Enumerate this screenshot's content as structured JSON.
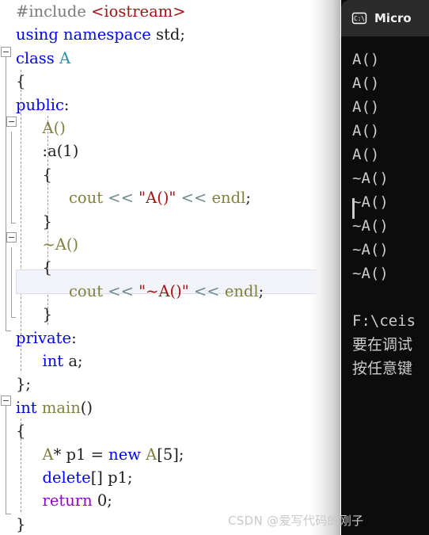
{
  "editor": {
    "lines": [
      {
        "indent": 0,
        "tokens": [
          {
            "t": "#include ",
            "c": "t-pre"
          },
          {
            "t": "<iostream>",
            "c": "t-inc"
          }
        ]
      },
      {
        "indent": 0,
        "tokens": [
          {
            "t": "using namespace",
            "c": "t-kw"
          },
          {
            "t": " std;",
            "c": "t-plain"
          }
        ]
      },
      {
        "indent": 0,
        "tokens": [
          {
            "t": "class",
            "c": "t-kw"
          },
          {
            "t": " ",
            "c": "t-plain"
          },
          {
            "t": "A",
            "c": "t-type"
          }
        ]
      },
      {
        "indent": 0,
        "tokens": [
          {
            "t": "{",
            "c": "t-plain"
          }
        ]
      },
      {
        "indent": 0,
        "tokens": [
          {
            "t": "public",
            "c": "t-kw"
          },
          {
            "t": ":",
            "c": "t-plain"
          }
        ]
      },
      {
        "indent": 1,
        "tokens": [
          {
            "t": "A()",
            "c": "t-ident"
          }
        ]
      },
      {
        "indent": 1,
        "tokens": [
          {
            "t": ":a(1)",
            "c": "t-plain"
          }
        ]
      },
      {
        "indent": 1,
        "tokens": [
          {
            "t": "{",
            "c": "t-plain"
          }
        ]
      },
      {
        "indent": 2,
        "tokens": [
          {
            "t": "cout",
            "c": "t-ident"
          },
          {
            "t": " ",
            "c": "t-plain"
          },
          {
            "t": "<<",
            "c": "t-op"
          },
          {
            "t": " ",
            "c": "t-plain"
          },
          {
            "t": "\"A()\"",
            "c": "t-str"
          },
          {
            "t": " ",
            "c": "t-plain"
          },
          {
            "t": "<<",
            "c": "t-op"
          },
          {
            "t": " ",
            "c": "t-plain"
          },
          {
            "t": "endl",
            "c": "t-ident"
          },
          {
            "t": ";",
            "c": "t-plain"
          }
        ]
      },
      {
        "indent": 1,
        "tokens": [
          {
            "t": "}",
            "c": "t-plain"
          }
        ]
      },
      {
        "indent": 1,
        "tokens": [
          {
            "t": "~A()",
            "c": "t-ident"
          }
        ]
      },
      {
        "indent": 1,
        "tokens": [
          {
            "t": "{",
            "c": "t-plain"
          }
        ]
      },
      {
        "indent": 2,
        "tokens": [
          {
            "t": "cout",
            "c": "t-ident"
          },
          {
            "t": " ",
            "c": "t-plain"
          },
          {
            "t": "<<",
            "c": "t-op"
          },
          {
            "t": " ",
            "c": "t-plain"
          },
          {
            "t": "\"~A()\"",
            "c": "t-str"
          },
          {
            "t": " ",
            "c": "t-plain"
          },
          {
            "t": "<<",
            "c": "t-op"
          },
          {
            "t": " ",
            "c": "t-plain"
          },
          {
            "t": "endl",
            "c": "t-ident"
          },
          {
            "t": ";",
            "c": "t-plain"
          }
        ]
      },
      {
        "indent": 1,
        "tokens": [
          {
            "t": "}",
            "c": "t-plain"
          }
        ]
      },
      {
        "indent": 0,
        "tokens": [
          {
            "t": "private",
            "c": "t-kw"
          },
          {
            "t": ":",
            "c": "t-plain"
          }
        ]
      },
      {
        "indent": 1,
        "tokens": [
          {
            "t": "int",
            "c": "t-kw"
          },
          {
            "t": " a;",
            "c": "t-plain"
          }
        ]
      },
      {
        "indent": 0,
        "tokens": [
          {
            "t": "};",
            "c": "t-plain"
          }
        ]
      },
      {
        "indent": 0,
        "tokens": [
          {
            "t": "int",
            "c": "t-kw"
          },
          {
            "t": " ",
            "c": "t-plain"
          },
          {
            "t": "main",
            "c": "t-ident"
          },
          {
            "t": "()",
            "c": "t-plain"
          }
        ]
      },
      {
        "indent": 0,
        "tokens": [
          {
            "t": "{",
            "c": "t-plain"
          }
        ]
      },
      {
        "indent": 1,
        "tokens": [
          {
            "t": "A",
            "c": "t-ident"
          },
          {
            "t": "* p1 = ",
            "c": "t-plain"
          },
          {
            "t": "new",
            "c": "t-kw"
          },
          {
            "t": " ",
            "c": "t-plain"
          },
          {
            "t": "A",
            "c": "t-ident"
          },
          {
            "t": "[5];",
            "c": "t-plain"
          }
        ]
      },
      {
        "indent": 1,
        "tokens": [
          {
            "t": "delete",
            "c": "t-kw"
          },
          {
            "t": "[]",
            "c": "t-brkt"
          },
          {
            "t": " p1;",
            "c": "t-plain"
          }
        ]
      },
      {
        "indent": 1,
        "tokens": [
          {
            "t": "return",
            "c": "t-ctrl"
          },
          {
            "t": " 0;",
            "c": "t-plain"
          }
        ]
      },
      {
        "indent": 0,
        "tokens": [
          {
            "t": "}",
            "c": "t-plain"
          }
        ]
      }
    ],
    "highlighted_line_index": 12,
    "collapse_markers": [
      "class A",
      "A() constructor",
      "~A() destructor",
      "int main()"
    ],
    "colors": {
      "background": "#ffffff",
      "keyword": "#0000ff",
      "type": "#2b91af",
      "identifier": "#808040",
      "string": "#a31515",
      "preprocessor": "#7b7b7b",
      "operator": "#6d8b8b",
      "control": "#8f08c4",
      "highlight_fill": "#f2f2f9",
      "highlight_border": "#dcdcec"
    }
  },
  "console": {
    "icon": "terminal-cmd-icon",
    "title": "Micro",
    "background": "#0c0c0c",
    "titlebar_background": "#2b2b2b",
    "output": [
      "A()",
      "A()",
      "A()",
      "A()",
      "A()",
      "~A()",
      "~A()",
      "~A()",
      "~A()",
      "~A()",
      "",
      "F:\\ceis",
      "要在调试",
      "按任意键"
    ]
  },
  "watermark": {
    "text": "CSDN @爱写代码的刚子"
  }
}
